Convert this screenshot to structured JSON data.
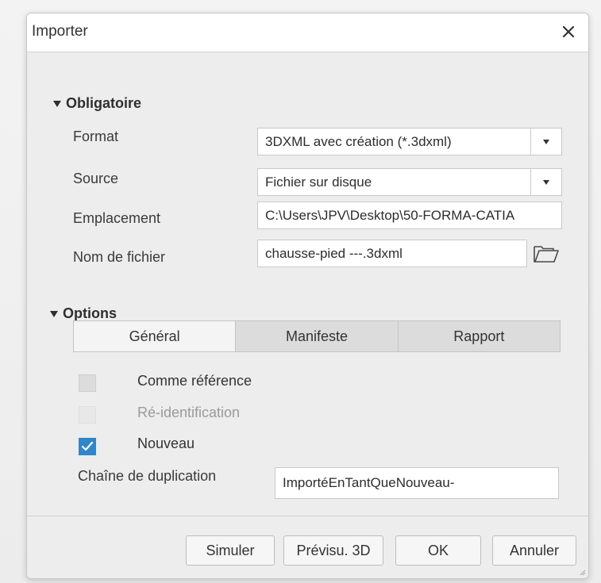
{
  "dialog": {
    "title": "Importer",
    "close_icon": "close-icon"
  },
  "required": {
    "header": "Obligatoire",
    "format": {
      "label": "Format",
      "value": "3DXML avec création (*.3dxml)"
    },
    "source": {
      "label": "Source",
      "value": "Fichier sur disque"
    },
    "location": {
      "label": "Emplacement",
      "value": "C:\\Users\\JPV\\Desktop\\50-FORMA-CATIA"
    },
    "filename": {
      "label": "Nom de fichier",
      "value": "chausse-pied ---.3dxml",
      "browse_icon": "folder-open-icon"
    }
  },
  "options": {
    "header": "Options",
    "tabs": [
      "Général",
      "Manifeste",
      "Rapport"
    ],
    "checkboxes": [
      {
        "label": "Comme référence",
        "checked": false,
        "disabled": false
      },
      {
        "label": "Ré-identification",
        "checked": false,
        "disabled": true
      },
      {
        "label": "Nouveau",
        "checked": true,
        "disabled": false
      }
    ],
    "dup_chain": {
      "label": "Chaîne de duplication",
      "value": "ImportéEnTantQueNouveau-"
    }
  },
  "footer": {
    "simulate": "Simuler",
    "preview3d": "Prévisu. 3D",
    "ok": "OK",
    "cancel": "Annuler"
  },
  "colors": {
    "accent": "#2f86c8",
    "panel": "#ededed",
    "tab_inactive": "#dcdcdc"
  }
}
